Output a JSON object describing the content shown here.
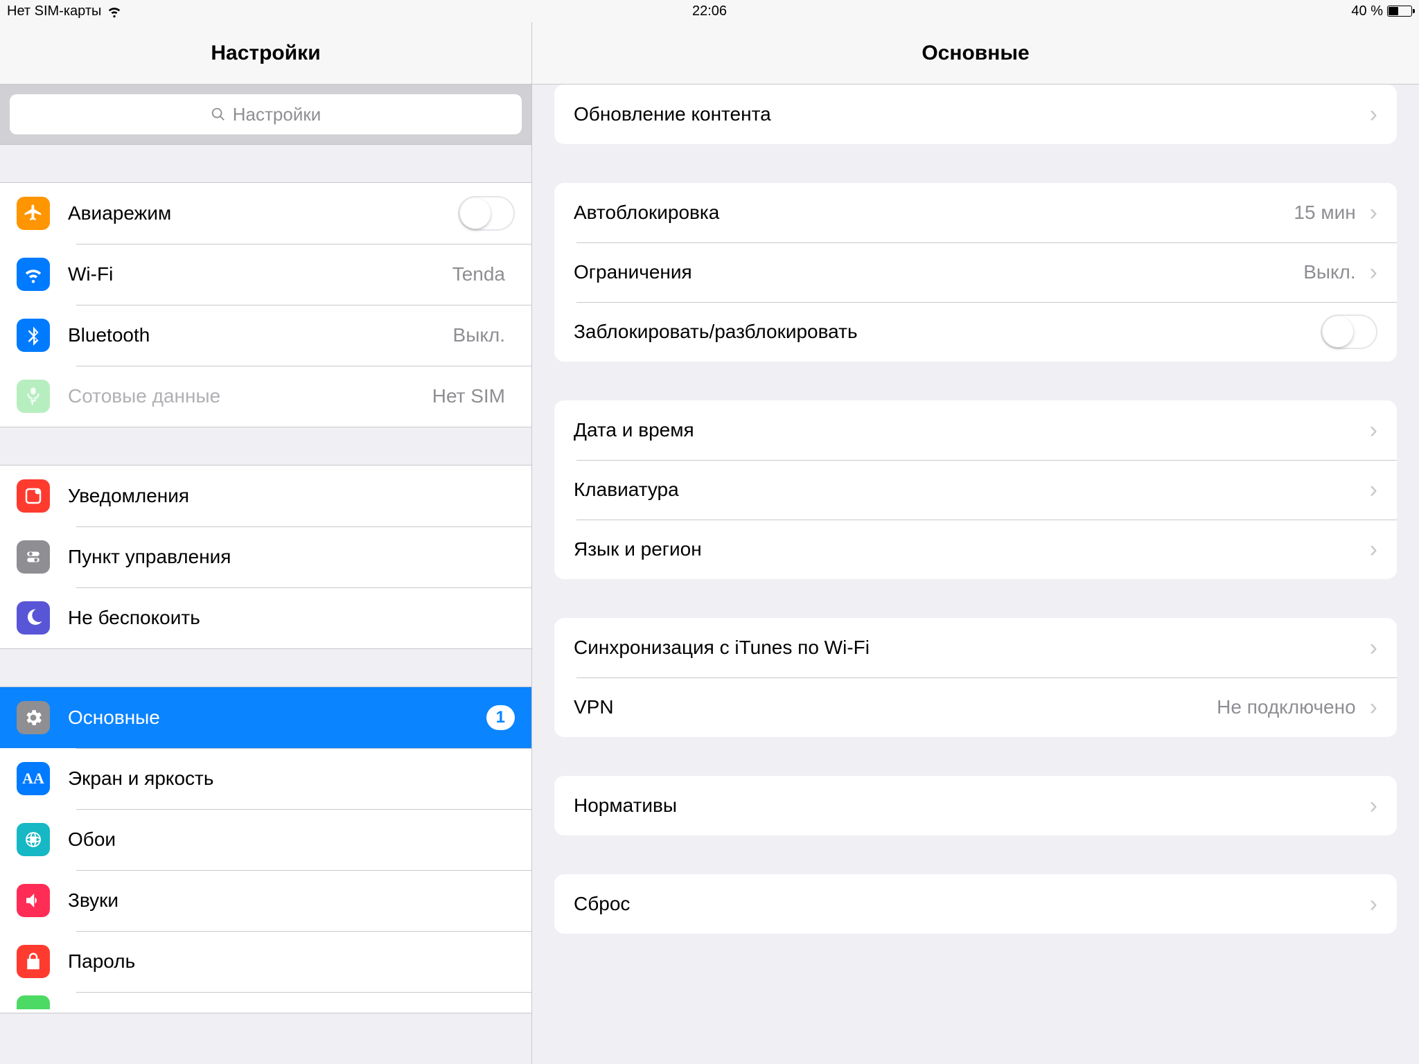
{
  "status": {
    "carrier": "Нет SIM-карты",
    "time": "22:06",
    "battery_text": "40 %"
  },
  "sidebar": {
    "title": "Настройки",
    "search_placeholder": "Настройки",
    "groups": [
      {
        "rows": [
          {
            "key": "airplane",
            "label": "Авиарежим",
            "control": "switch"
          },
          {
            "key": "wifi",
            "label": "Wi-Fi",
            "value": "Tenda"
          },
          {
            "key": "bluetooth",
            "label": "Bluetooth",
            "value": "Выкл."
          },
          {
            "key": "cellular",
            "label": "Сотовые данные",
            "value": "Нет SIM",
            "dimmed": true
          }
        ]
      },
      {
        "rows": [
          {
            "key": "notifications",
            "label": "Уведомления"
          },
          {
            "key": "control",
            "label": "Пункт управления"
          },
          {
            "key": "dnd",
            "label": "Не беспокоить"
          }
        ]
      },
      {
        "rows": [
          {
            "key": "general",
            "label": "Основные",
            "badge": "1",
            "selected": true
          },
          {
            "key": "display",
            "label": "Экран и яркость"
          },
          {
            "key": "wallpaper",
            "label": "Обои"
          },
          {
            "key": "sounds",
            "label": "Звуки"
          },
          {
            "key": "passcode",
            "label": "Пароль"
          },
          {
            "key": "green",
            "label": ""
          }
        ]
      }
    ]
  },
  "detail": {
    "title": "Основные",
    "groups": [
      {
        "rows": [
          {
            "label": "Обновление контента",
            "chevron": true
          }
        ]
      },
      {
        "rows": [
          {
            "label": "Автоблокировка",
            "value": "15 мин",
            "chevron": true
          },
          {
            "label": "Ограничения",
            "value": "Выкл.",
            "chevron": true
          },
          {
            "label": "Заблокировать/разблокировать",
            "control": "switch"
          }
        ]
      },
      {
        "rows": [
          {
            "label": "Дата и время",
            "chevron": true
          },
          {
            "label": "Клавиатура",
            "chevron": true
          },
          {
            "label": "Язык и регион",
            "chevron": true
          }
        ]
      },
      {
        "rows": [
          {
            "label": "Синхронизация с iTunes по Wi-Fi",
            "chevron": true
          },
          {
            "label": "VPN",
            "value": "Не подключено",
            "chevron": true
          }
        ]
      },
      {
        "rows": [
          {
            "label": "Нормативы",
            "chevron": true
          }
        ]
      },
      {
        "rows": [
          {
            "label": "Сброс",
            "chevron": true
          }
        ]
      }
    ]
  }
}
